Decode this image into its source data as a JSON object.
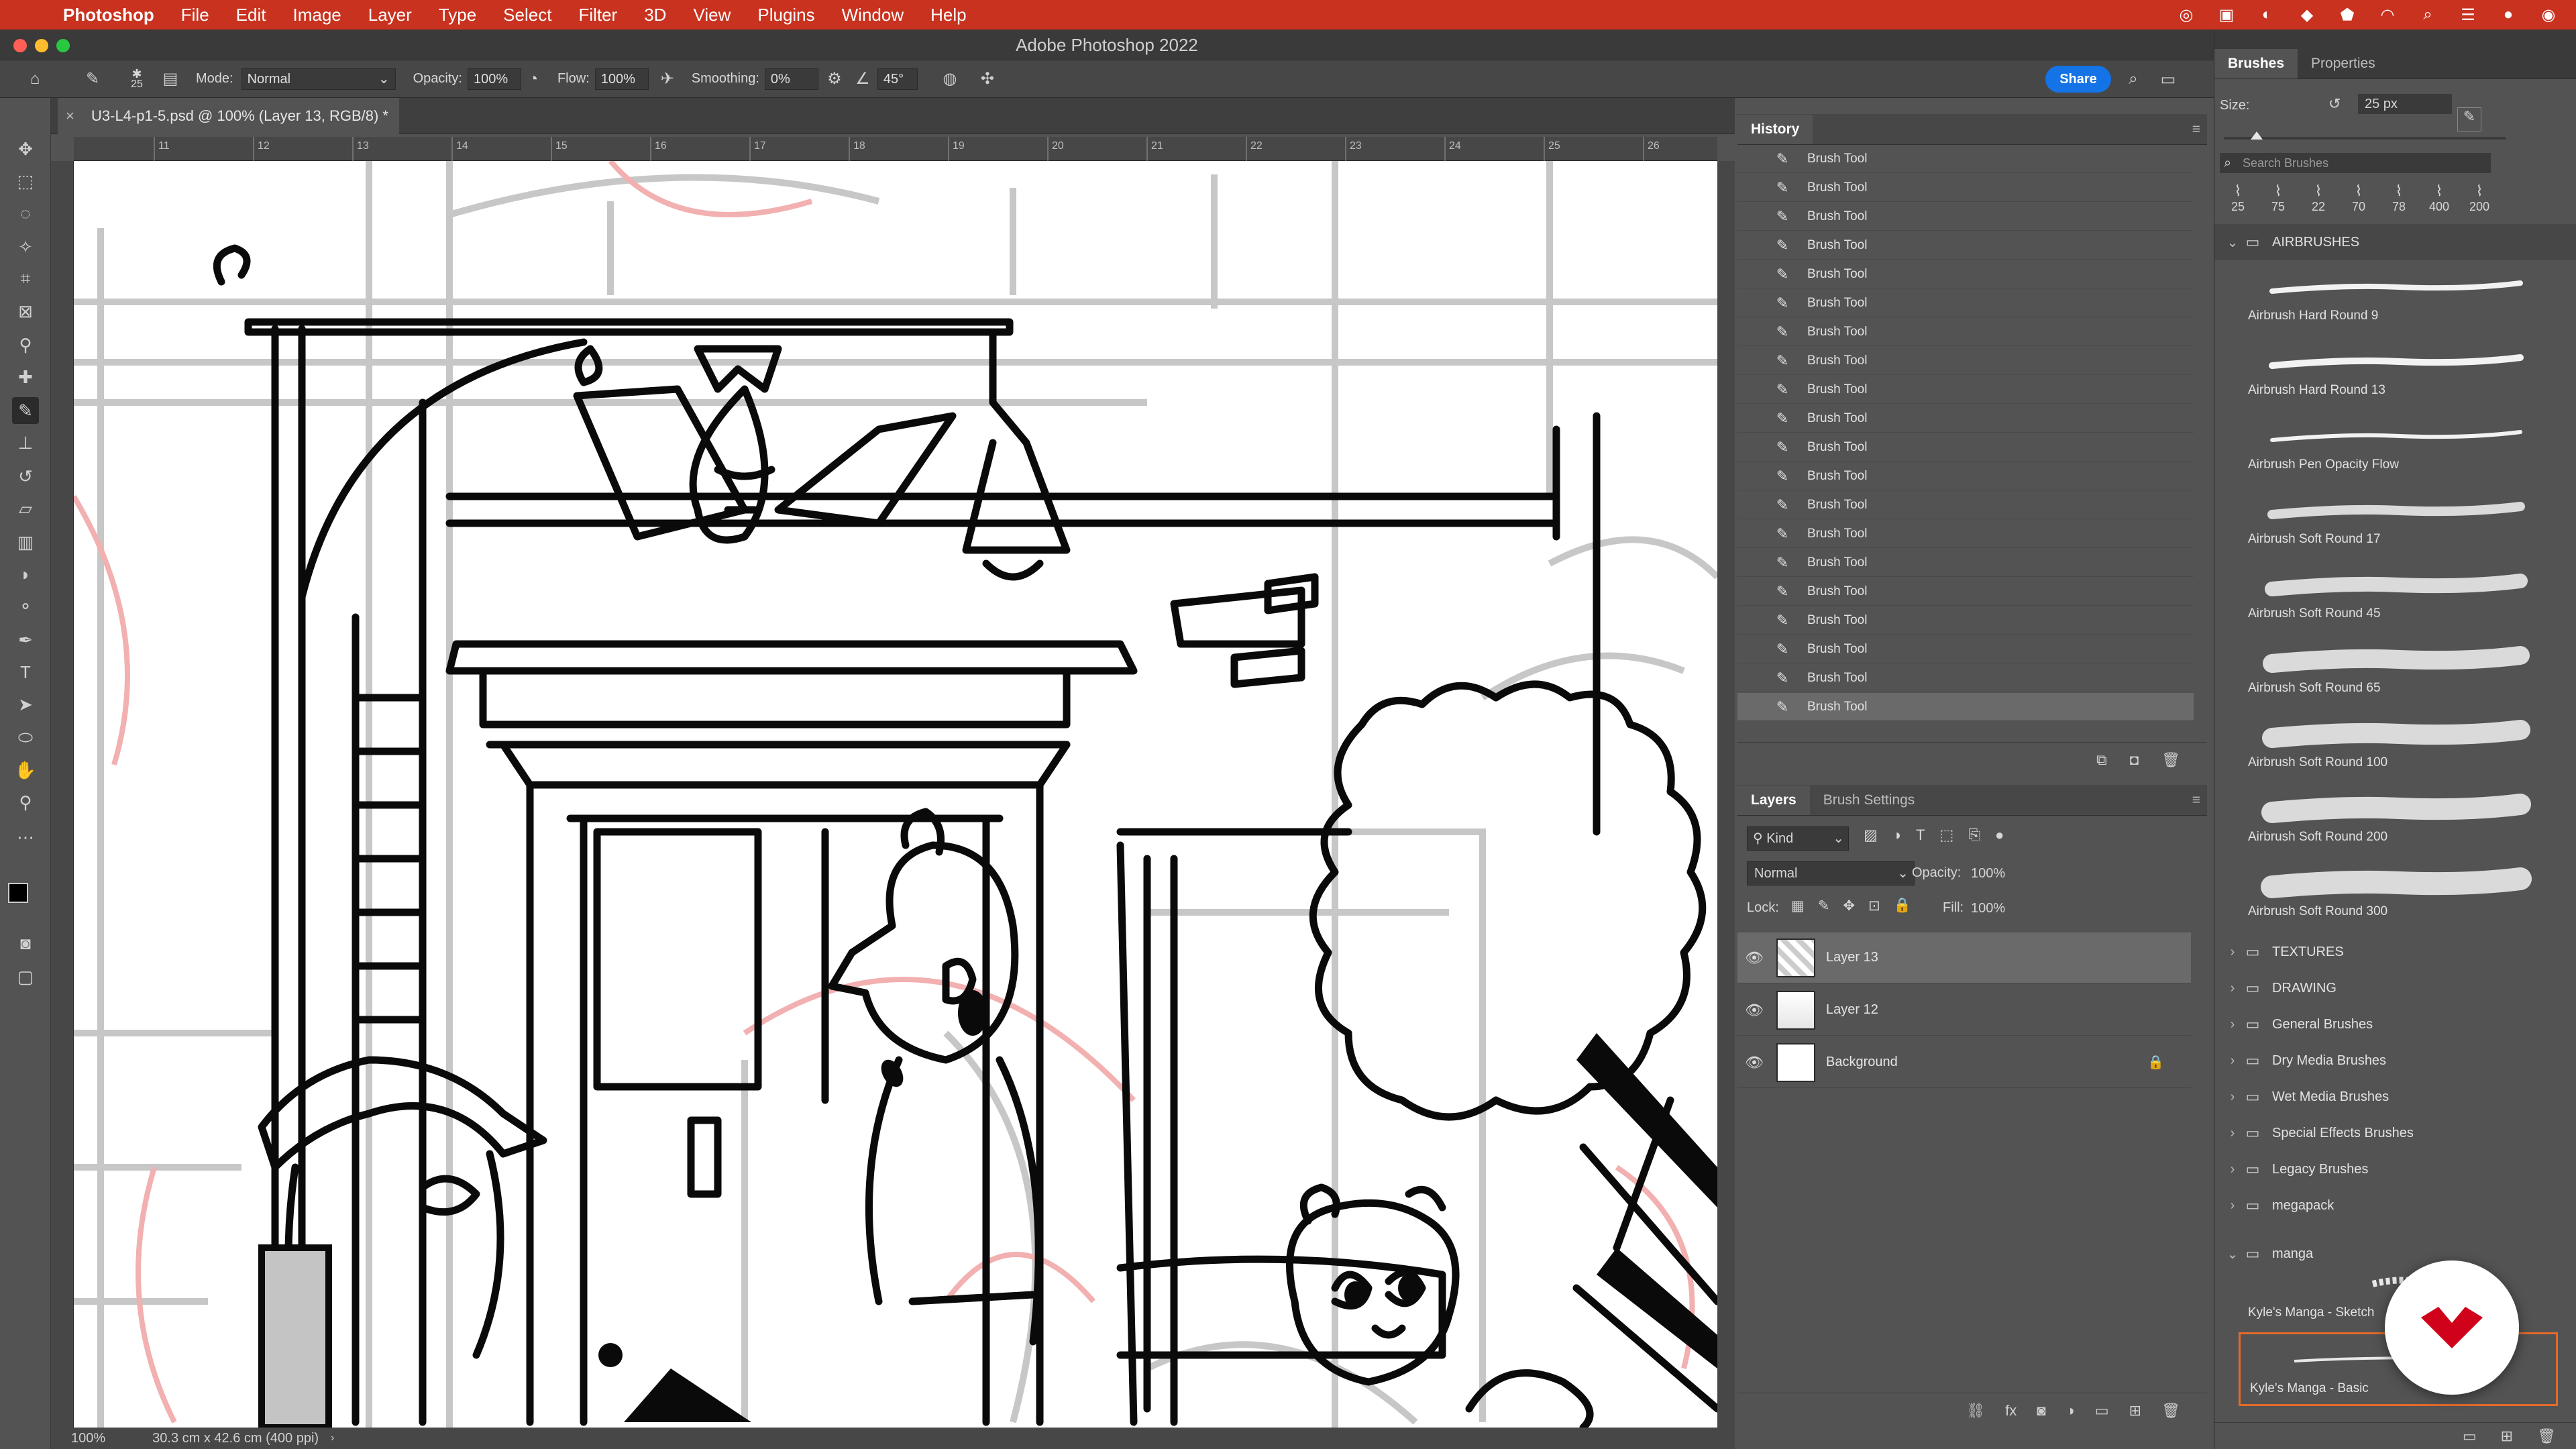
{
  "menubar": {
    "app": "Photoshop",
    "items": [
      "File",
      "Edit",
      "Image",
      "Layer",
      "Type",
      "Select",
      "Filter",
      "3D",
      "View",
      "Plugins",
      "Window",
      "Help"
    ],
    "accent_color": "#c8321f"
  },
  "window": {
    "title": "Adobe Photoshop 2022"
  },
  "options": {
    "brush_size": "25",
    "mode_label": "Mode:",
    "mode_value": "Normal",
    "opacity_label": "Opacity:",
    "opacity_value": "100%",
    "flow_label": "Flow:",
    "flow_value": "100%",
    "smoothing_label": "Smoothing:",
    "smoothing_value": "0%",
    "angle_value": "45°",
    "share_label": "Share"
  },
  "document": {
    "tab_title": "U3-L4-p1-5.psd @ 100% (Layer 13, RGB/8) *",
    "ruler_marks": [
      "11",
      "12",
      "13",
      "14",
      "15",
      "16",
      "17",
      "18",
      "19",
      "20",
      "21",
      "22",
      "23",
      "24",
      "25",
      "26"
    ],
    "zoom": "100%",
    "dimensions": "30.3 cm x 42.6 cm (400 ppi)"
  },
  "history": {
    "title": "History",
    "items": [
      "Brush Tool",
      "Brush Tool",
      "Brush Tool",
      "Brush Tool",
      "Brush Tool",
      "Brush Tool",
      "Brush Tool",
      "Brush Tool",
      "Brush Tool",
      "Brush Tool",
      "Brush Tool",
      "Brush Tool",
      "Brush Tool",
      "Brush Tool",
      "Brush Tool",
      "Brush Tool",
      "Brush Tool",
      "Brush Tool",
      "Brush Tool",
      "Brush Tool"
    ]
  },
  "layers": {
    "tabs": [
      "Layers",
      "Brush Settings"
    ],
    "filter_label": "Kind",
    "blend_mode": "Normal",
    "opacity_label": "Opacity:",
    "opacity_value": "100%",
    "lock_label": "Lock:",
    "fill_label": "Fill:",
    "fill_value": "100%",
    "items": [
      {
        "name": "Layer 13",
        "selected": true
      },
      {
        "name": "Layer 12",
        "selected": false
      },
      {
        "name": "Background",
        "selected": false,
        "locked": true
      }
    ]
  },
  "brushes": {
    "tabs": [
      "Brushes",
      "Properties"
    ],
    "size_label": "Size:",
    "size_value": "25 px",
    "search_placeholder": "Search Brushes",
    "recent_sizes": [
      "25",
      "75",
      "22",
      "70",
      "78",
      "400",
      "200"
    ],
    "airbrushes_folder": "AIRBRUSHES",
    "airbrush_items": [
      "Airbrush Hard Round 9",
      "Airbrush Hard Round 13",
      "Airbrush Pen Opacity Flow",
      "Airbrush Soft Round 17",
      "Airbrush Soft Round 45",
      "Airbrush Soft Round 65",
      "Airbrush Soft Round 100",
      "Airbrush Soft Round 200",
      "Airbrush Soft Round 300"
    ],
    "folders": [
      "TEXTURES",
      "DRAWING",
      "General Brushes",
      "Dry Media Brushes",
      "Wet Media Brushes",
      "Special Effects Brushes",
      "Legacy Brushes",
      "megapack"
    ],
    "manga_folder": "manga",
    "manga_items": [
      "Kyle's Manga - Sketch",
      "Kyle's Manga - Basic"
    ]
  },
  "icons": {
    "apple": "apple-icon",
    "home": "home-icon",
    "brush": "brush-icon",
    "search": "search-icon",
    "eye": "eye-icon",
    "lock": "lock-icon",
    "folder": "folder-icon",
    "trash": "trash-icon",
    "camera": "camera-icon",
    "plus": "plus-icon",
    "logo": "domestika-logo-icon"
  }
}
